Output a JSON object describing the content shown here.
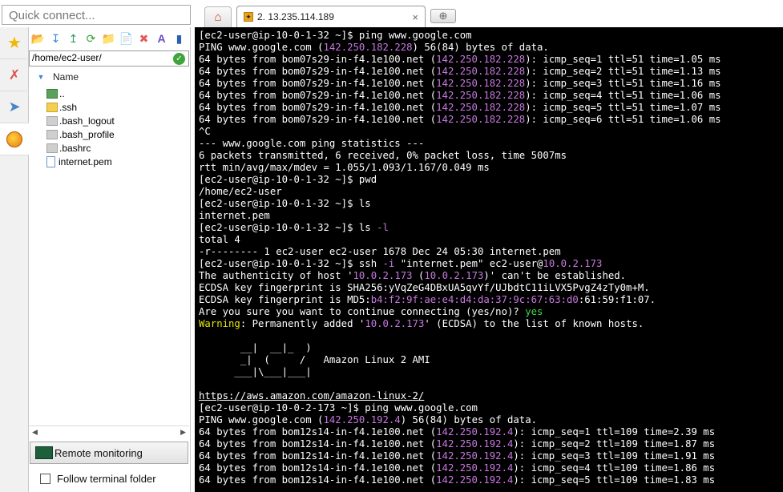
{
  "quick_connect": {
    "placeholder": "Quick connect..."
  },
  "tabs": {
    "session_label": "2. 13.235.114.189",
    "close_glyph": "×",
    "new_tab_glyph": "⊕"
  },
  "rail": {
    "icons": [
      "star-icon",
      "tools-icon",
      "send-icon",
      "sftp-globe-icon"
    ]
  },
  "sftp": {
    "path": "/home/ec2-user/",
    "column_header": "Name",
    "files": [
      {
        "name": "..",
        "type": "up"
      },
      {
        "name": ".ssh",
        "type": "folder"
      },
      {
        "name": ".bash_logout",
        "type": "doc"
      },
      {
        "name": ".bash_profile",
        "type": "doc"
      },
      {
        "name": ".bashrc",
        "type": "doc"
      },
      {
        "name": "internet.pem",
        "type": "pem"
      }
    ],
    "remote_monitoring": "Remote monitoring",
    "follow_terminal": "Follow terminal folder"
  },
  "terminal": {
    "lines": [
      [
        {
          "t": "[ec2-user@ip-10-0-1-32 ~]$ ping www.google.com"
        }
      ],
      [
        {
          "t": "PING www.google.com ("
        },
        {
          "t": "142.250.182.228",
          "c": "ip"
        },
        {
          "t": ") 56(84) bytes of data."
        }
      ],
      [
        {
          "t": "64 bytes from bom07s29-in-f4.1e100.net ("
        },
        {
          "t": "142.250.182.228",
          "c": "ip"
        },
        {
          "t": "): icmp_seq=1 ttl=51 time=1.05 ms"
        }
      ],
      [
        {
          "t": "64 bytes from bom07s29-in-f4.1e100.net ("
        },
        {
          "t": "142.250.182.228",
          "c": "ip"
        },
        {
          "t": "): icmp_seq=2 ttl=51 time=1.13 ms"
        }
      ],
      [
        {
          "t": "64 bytes from bom07s29-in-f4.1e100.net ("
        },
        {
          "t": "142.250.182.228",
          "c": "ip"
        },
        {
          "t": "): icmp_seq=3 ttl=51 time=1.16 ms"
        }
      ],
      [
        {
          "t": "64 bytes from bom07s29-in-f4.1e100.net ("
        },
        {
          "t": "142.250.182.228",
          "c": "ip"
        },
        {
          "t": "): icmp_seq=4 ttl=51 time=1.06 ms"
        }
      ],
      [
        {
          "t": "64 bytes from bom07s29-in-f4.1e100.net ("
        },
        {
          "t": "142.250.182.228",
          "c": "ip"
        },
        {
          "t": "): icmp_seq=5 ttl=51 time=1.07 ms"
        }
      ],
      [
        {
          "t": "64 bytes from bom07s29-in-f4.1e100.net ("
        },
        {
          "t": "142.250.182.228",
          "c": "ip"
        },
        {
          "t": "): icmp_seq=6 ttl=51 time=1.06 ms"
        }
      ],
      [
        {
          "t": "^C"
        }
      ],
      [
        {
          "t": "--- www.google.com ping statistics ---"
        }
      ],
      [
        {
          "t": "6 packets transmitted, 6 received, 0% packet loss, time 5007ms"
        }
      ],
      [
        {
          "t": "rtt min/avg/max/mdev = 1.055/1.093/1.167/0.049 ms"
        }
      ],
      [
        {
          "t": "[ec2-user@ip-10-0-1-32 ~]$ pwd"
        }
      ],
      [
        {
          "t": "/home/ec2-user"
        }
      ],
      [
        {
          "t": "[ec2-user@ip-10-0-1-32 ~]$ ls"
        }
      ],
      [
        {
          "t": "internet.pem"
        }
      ],
      [
        {
          "t": "[ec2-user@ip-10-0-1-32 ~]$ ls "
        },
        {
          "t": "-l",
          "c": "ip"
        }
      ],
      [
        {
          "t": "total 4"
        }
      ],
      [
        {
          "t": "-r-------- 1 ec2-user ec2-user 1678 Dec 24 05:30 internet.pem"
        }
      ],
      [
        {
          "t": "[ec2-user@ip-10-0-1-32 ~]$ ssh "
        },
        {
          "t": "-i",
          "c": "ip"
        },
        {
          "t": " \"internet.pem\" ec2-user@"
        },
        {
          "t": "10.0.2.173",
          "c": "ip"
        }
      ],
      [
        {
          "t": "The authenticity of host '"
        },
        {
          "t": "10.0.2.173",
          "c": "ip"
        },
        {
          "t": " ("
        },
        {
          "t": "10.0.2.173",
          "c": "ip"
        },
        {
          "t": ")' can't be established."
        }
      ],
      [
        {
          "t": "ECDSA key fingerprint is SHA256:yVqZeG4DBxUA5qvYf/UJbdtC11iLVX5PvgZ4zTy0m+M."
        }
      ],
      [
        {
          "t": "ECDSA key fingerprint is MD5:"
        },
        {
          "t": "b4:f2:9f:ae:e4:d4:da:37:9c:67:63:d0",
          "c": "ip"
        },
        {
          "t": ":61:59:f1:07."
        }
      ],
      [
        {
          "t": "Are you sure you want to continue connecting (yes/no)? "
        },
        {
          "t": "yes",
          "c": "grn"
        }
      ],
      [
        {
          "t": "Warning",
          "c": "ylw"
        },
        {
          "t": ": Permanently added '"
        },
        {
          "t": "10.0.2.173",
          "c": "ip"
        },
        {
          "t": "' (ECDSA) to the list of known hosts."
        }
      ],
      [
        {
          "t": ""
        }
      ],
      [
        {
          "t": "       __|  __|_  )"
        }
      ],
      [
        {
          "t": "       _|  (     /   Amazon Linux 2 AMI"
        }
      ],
      [
        {
          "t": "      ___|\\___|___|"
        }
      ],
      [
        {
          "t": ""
        }
      ],
      [
        {
          "t": "https://aws.amazon.com/amazon-linux-2/",
          "c": "ul"
        }
      ],
      [
        {
          "t": "[ec2-user@ip-10-0-2-173 ~]$ ping www.google.com"
        }
      ],
      [
        {
          "t": "PING www.google.com ("
        },
        {
          "t": "142.250.192.4",
          "c": "ip"
        },
        {
          "t": ") 56(84) bytes of data."
        }
      ],
      [
        {
          "t": "64 bytes from bom12s14-in-f4.1e100.net ("
        },
        {
          "t": "142.250.192.4",
          "c": "ip"
        },
        {
          "t": "): icmp_seq=1 ttl=109 time=2.39 ms"
        }
      ],
      [
        {
          "t": "64 bytes from bom12s14-in-f4.1e100.net ("
        },
        {
          "t": "142.250.192.4",
          "c": "ip"
        },
        {
          "t": "): icmp_seq=2 ttl=109 time=1.87 ms"
        }
      ],
      [
        {
          "t": "64 bytes from bom12s14-in-f4.1e100.net ("
        },
        {
          "t": "142.250.192.4",
          "c": "ip"
        },
        {
          "t": "): icmp_seq=3 ttl=109 time=1.91 ms"
        }
      ],
      [
        {
          "t": "64 bytes from bom12s14-in-f4.1e100.net ("
        },
        {
          "t": "142.250.192.4",
          "c": "ip"
        },
        {
          "t": "): icmp_seq=4 ttl=109 time=1.86 ms"
        }
      ],
      [
        {
          "t": "64 bytes from bom12s14-in-f4.1e100.net ("
        },
        {
          "t": "142.250.192.4",
          "c": "ip"
        },
        {
          "t": "): icmp_seq=5 ttl=109 time=1.83 ms"
        }
      ]
    ]
  },
  "colors": {
    "terminal_bg": "#000000",
    "ip_purple": "#c678dd",
    "warning_yellow": "#e5e510",
    "yes_green": "#3fd84e"
  }
}
